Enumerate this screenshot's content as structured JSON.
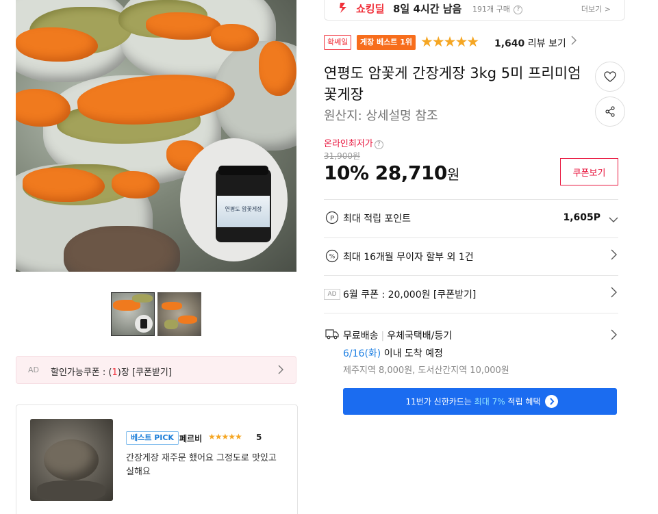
{
  "deal": {
    "name": "쇼킹딜",
    "timer": "8일 4시간 남음",
    "purchases": "191개 구매",
    "more": "더보기 >"
  },
  "product": {
    "badge_mon": "확쎄일",
    "badge_best": "게장 베스트 1위",
    "rating_stars": "★★★★★",
    "rating_value": 4.7,
    "review_count": "1,640",
    "review_link": "리뷰 보기",
    "title": "연평도 암꽃게 간장게장 3kg 5미 프리미엄 꽃게장",
    "origin": "원산지: 상세설명 참조",
    "jar_label": "연평도 암꽃게장"
  },
  "price": {
    "lowest_label": "온라인최저가",
    "original": "31,900원",
    "discount": "10%",
    "amount": "28,710",
    "unit": "원",
    "coupon_button": "쿠폰보기"
  },
  "benefits": {
    "points_label": "최대 적립 포인트",
    "points_value": "1,605P",
    "installment": "최대 16개월 무이자 할부 외 1건",
    "ad_tag": "AD",
    "june_coupon": "6월 쿠폰 : 20,000원 [쿠폰받기]"
  },
  "shipping": {
    "free": "무료배송",
    "carrier": "우체국택배/등기",
    "date": "6/16(화)",
    "date_suffix": " 이내 도착 예정",
    "extra": "제주지역 8,000원, 도서산간지역 10,000원"
  },
  "card_banner": {
    "prefix": "11번가 신한카드는",
    "highlight": "최대 7%",
    "suffix": "적립 혜택"
  },
  "left_ad": {
    "tag": "AD",
    "text_prefix": "할인가능쿠폰 : (",
    "count": "1",
    "text_suffix": ")장 [쿠폰받기]"
  },
  "review": {
    "badge": "베스트 PICK",
    "reviewer": "페르비",
    "stars": "★★★★★",
    "score": "5",
    "text": "간장게장 재주문 했어요 그정도로 맛있고 실해요"
  },
  "colors": {
    "accent_red": "#f0303a",
    "best_orange": "#f76d1c",
    "star": "#f5a623",
    "banner_blue": "#1b6cf0",
    "link_blue": "#1f80e3"
  }
}
